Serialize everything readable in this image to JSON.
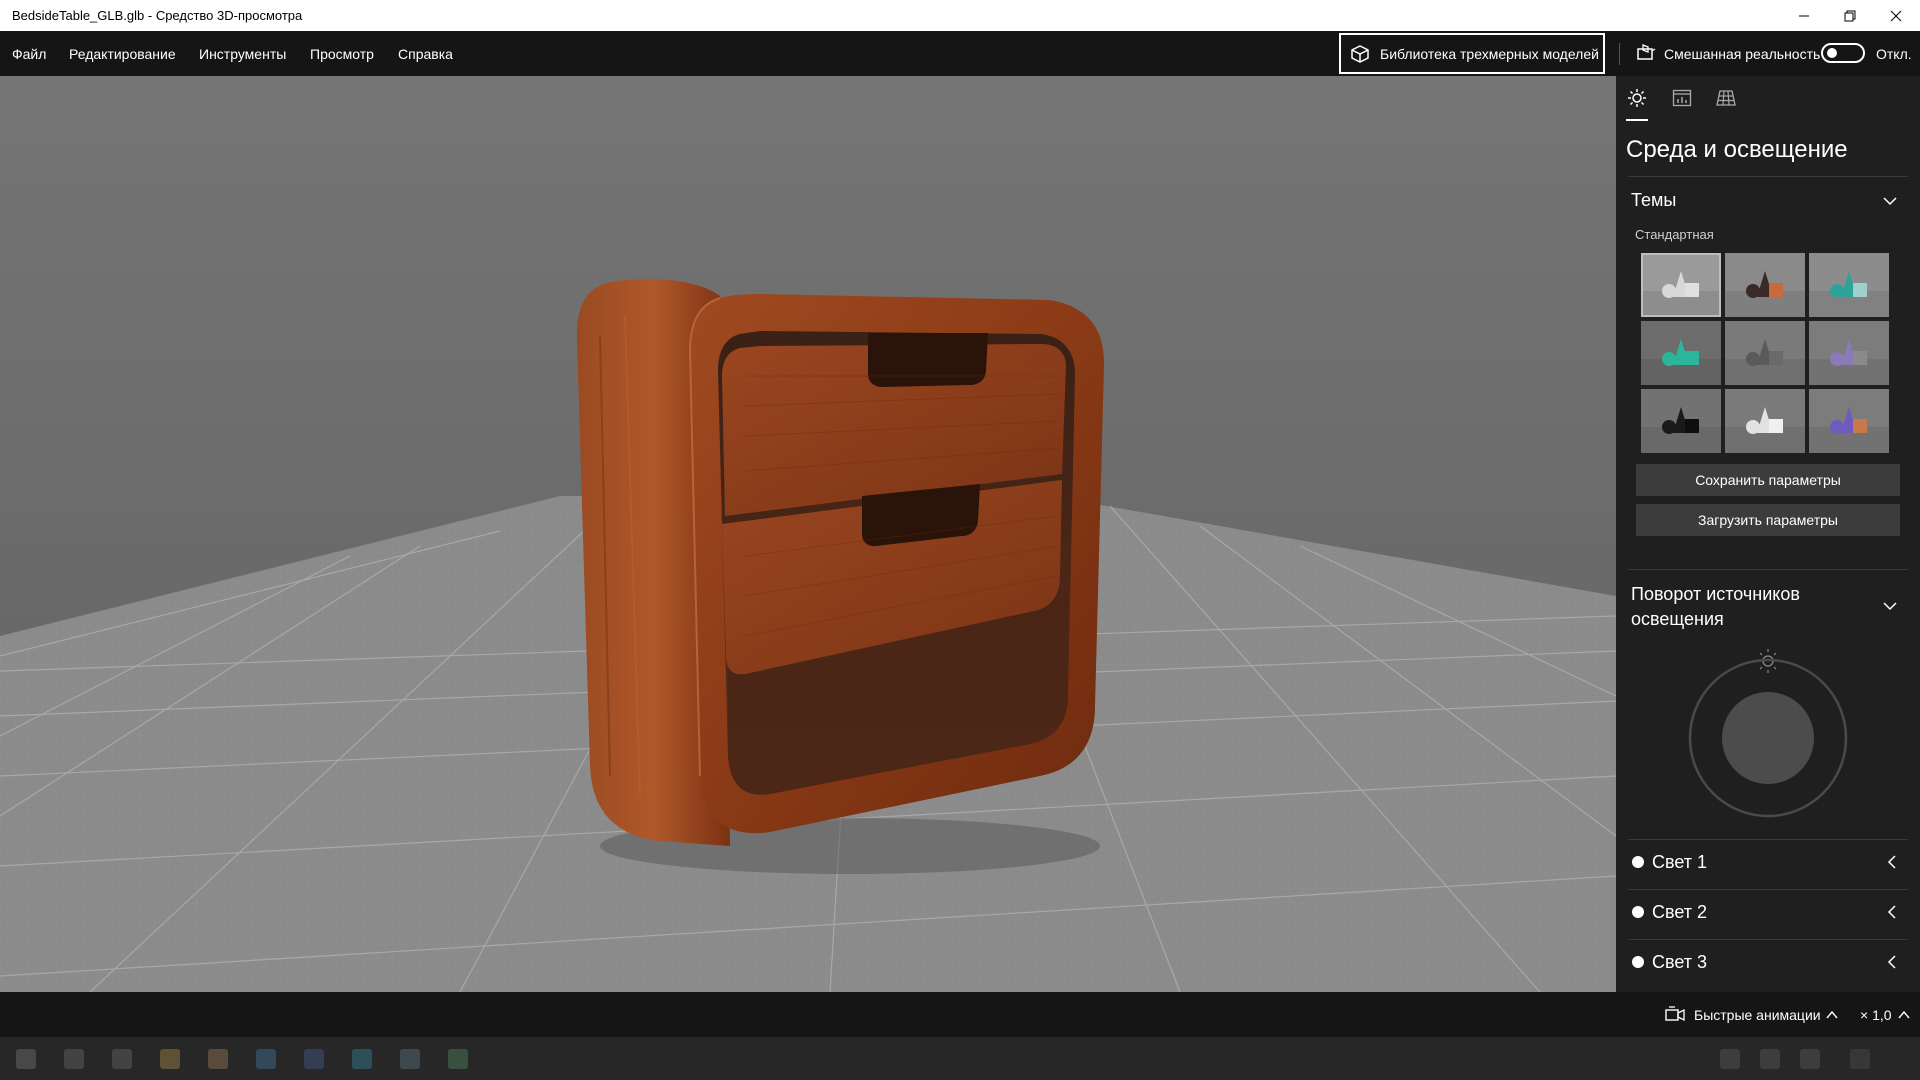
{
  "window": {
    "title": "BedsideTable_GLB.glb - Средство 3D-просмотра",
    "controls": [
      "minimize-icon",
      "restore-icon",
      "close-icon"
    ]
  },
  "menu": {
    "items": [
      "Файл",
      "Редактирование",
      "Инструменты",
      "Просмотр",
      "Справка"
    ],
    "library_button": "Библиотека трехмерных моделей",
    "mixed_reality_label": "Смешанная реальность",
    "toggle_state": "Откл."
  },
  "panel": {
    "tabs": [
      "sun-icon",
      "stats-icon",
      "grid-icon"
    ],
    "title": "Среда и освещение",
    "themes": {
      "header": "Темы",
      "group_label": "Стандартная",
      "tiles": [
        {
          "bg": "#9a9a9a",
          "a": "#d8d8d8",
          "b": "#e0e0e0"
        },
        {
          "bg": "#8a8a8a",
          "a": "#3a2a26",
          "b": "#c86a3a"
        },
        {
          "bg": "#8c8c8c",
          "a": "#2ea39a",
          "b": "#a0d0cc"
        },
        {
          "bg": "#6c6c6c",
          "a": "#2bb59a",
          "b": "#2bb59a"
        },
        {
          "bg": "#7a7a7a",
          "a": "#5a5a5a",
          "b": "#6a6a6a"
        },
        {
          "bg": "#7c7c7c",
          "a": "#8a7ab8",
          "b": "#8a8a8a"
        },
        {
          "bg": "#727272",
          "a": "#1a1a1a",
          "b": "#0e0e0e"
        },
        {
          "bg": "#7a7a7a",
          "a": "#e2e2e2",
          "b": "#f0f0f0"
        },
        {
          "bg": "#7c7c7c",
          "a": "#6f5ac0",
          "b": "#c8784a"
        }
      ],
      "save_button": "Сохранить параметры",
      "load_button": "Загрузить параметры"
    },
    "rotation": {
      "header": "Поворот источников освещения"
    },
    "lights": [
      {
        "label": "Свет 1"
      },
      {
        "label": "Свет 2"
      },
      {
        "label": "Свет 3"
      }
    ]
  },
  "status": {
    "animations_label": "Быстрые анимации",
    "speed": "× 1,0"
  },
  "colors": {
    "wood": "#8c3a18",
    "wood_light": "#b55a2c",
    "panel_bg": "#1f1f1f"
  }
}
